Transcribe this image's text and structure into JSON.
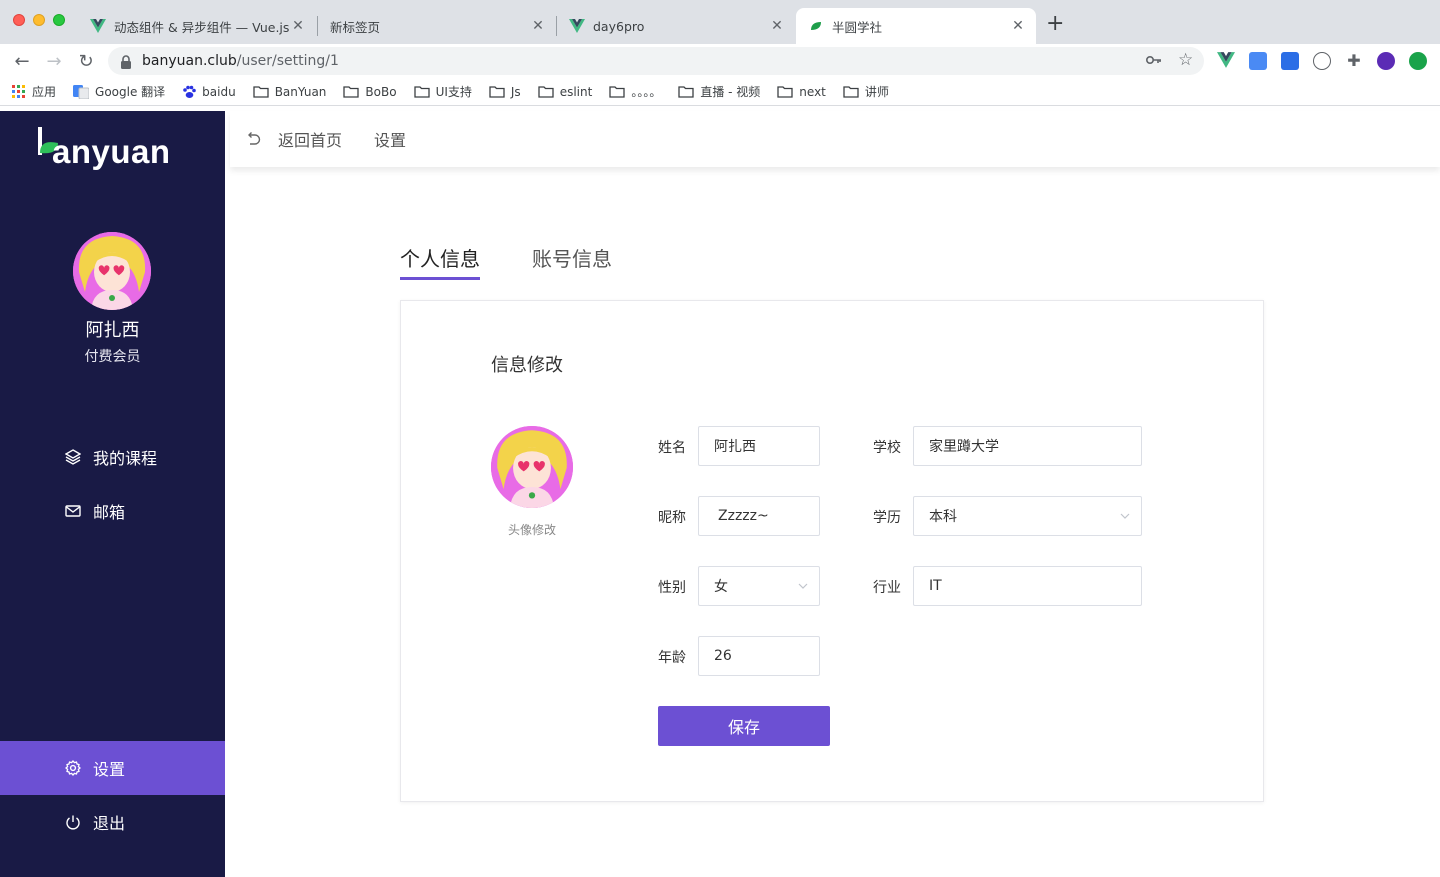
{
  "browser": {
    "tabs": [
      {
        "title": "动态组件 & 异步组件 — Vue.js",
        "icon": "vue-icon"
      },
      {
        "title": "新标签页",
        "icon": "none"
      },
      {
        "title": "day6pro",
        "icon": "vue-icon"
      },
      {
        "title": "半圆学社",
        "icon": "banyuan-leaf-icon"
      }
    ],
    "url_host": "banyuan.club",
    "url_path": "/user/setting/1",
    "bookmarks": [
      {
        "label": "应用",
        "icon": "apps-grid-icon"
      },
      {
        "label": "Google 翻译",
        "icon": "google-translate-icon"
      },
      {
        "label": "baidu",
        "icon": "baidu-paw-icon"
      },
      {
        "label": "BanYuan",
        "icon": "folder-icon"
      },
      {
        "label": "BoBo",
        "icon": "folder-icon"
      },
      {
        "label": "UI支持",
        "icon": "folder-icon"
      },
      {
        "label": "Js",
        "icon": "folder-icon"
      },
      {
        "label": "eslint",
        "icon": "folder-icon"
      },
      {
        "label": "。。。。",
        "icon": "folder-icon"
      },
      {
        "label": "直播 - 视频",
        "icon": "folder-icon"
      },
      {
        "label": "next",
        "icon": "folder-icon"
      },
      {
        "label": "讲师",
        "icon": "folder-icon"
      }
    ]
  },
  "sidebar": {
    "logo_text": "anyuan",
    "user_name": "阿扎西",
    "user_role": "付费会员",
    "menu": [
      {
        "label": "我的课程",
        "icon": "layers-icon"
      },
      {
        "label": "邮箱",
        "icon": "mail-icon"
      },
      {
        "label": "设置",
        "icon": "gear-icon"
      },
      {
        "label": "退出",
        "icon": "power-icon"
      }
    ]
  },
  "topbar": {
    "back_label": "返回首页",
    "current": "设置"
  },
  "page_tabs": [
    {
      "label": "个人信息",
      "active": true
    },
    {
      "label": "账号信息",
      "active": false
    }
  ],
  "form": {
    "title": "信息修改",
    "avatar_caption": "头像修改",
    "fields": {
      "name": {
        "label": "姓名",
        "value": "阿扎西"
      },
      "nickname": {
        "label": "昵称",
        "value": "Zzzzz~"
      },
      "gender": {
        "label": "性别",
        "value": "女"
      },
      "age": {
        "label": "年龄",
        "value": "26"
      },
      "school": {
        "label": "学校",
        "value": "家里蹲大学"
      },
      "education": {
        "label": "学历",
        "value": "本科"
      },
      "industry": {
        "label": "行业",
        "value": "IT"
      }
    },
    "save_label": "保存"
  },
  "colors": {
    "sidebar_bg": "#191a45",
    "accent": "#6c50d3"
  }
}
